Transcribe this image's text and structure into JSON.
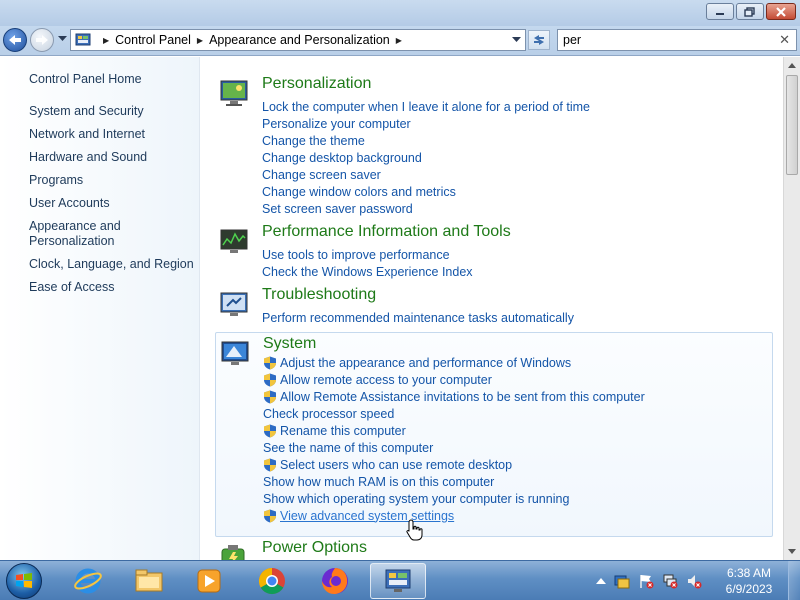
{
  "address_bar": {
    "breadcrumbs": [
      "Control Panel",
      "Appearance and Personalization"
    ],
    "search_value": "per"
  },
  "left_pane": {
    "home": "Control Panel Home",
    "items": [
      "System and Security",
      "Network and Internet",
      "Hardware and Sound",
      "Programs",
      "User Accounts",
      "Appearance and Personalization",
      "Clock, Language, and Region",
      "Ease of Access"
    ]
  },
  "sections": [
    {
      "title": "Personalization",
      "icon": "personalization-icon",
      "links": [
        {
          "label": "Lock the computer when I leave it alone for a period of time",
          "shield": false
        },
        {
          "label": "Personalize your computer",
          "shield": false
        },
        {
          "label": "Change the theme",
          "shield": false
        },
        {
          "label": "Change desktop background",
          "shield": false
        },
        {
          "label": "Change screen saver",
          "shield": false
        },
        {
          "label": "Change window colors and metrics",
          "shield": false
        },
        {
          "label": "Set screen saver password",
          "shield": false
        }
      ]
    },
    {
      "title": "Performance Information and Tools",
      "icon": "performance-icon",
      "links": [
        {
          "label": "Use tools to improve performance",
          "shield": false
        },
        {
          "label": "Check the Windows Experience Index",
          "shield": false
        }
      ]
    },
    {
      "title": "Troubleshooting",
      "icon": "troubleshooting-icon",
      "links": [
        {
          "label": "Perform recommended maintenance tasks automatically",
          "shield": false
        }
      ]
    },
    {
      "title": "System",
      "icon": "system-icon",
      "links": [
        {
          "label": "Adjust the appearance and performance of Windows",
          "shield": true
        },
        {
          "label": "Allow remote access to your computer",
          "shield": true
        },
        {
          "label": "Allow Remote Assistance invitations to be sent from this computer",
          "shield": true
        },
        {
          "label": "Check processor speed",
          "shield": false
        },
        {
          "label": "Rename this computer",
          "shield": true
        },
        {
          "label": "See the name of this computer",
          "shield": false
        },
        {
          "label": "Select users who can use remote desktop",
          "shield": true
        },
        {
          "label": "Show how much RAM is on this computer",
          "shield": false
        },
        {
          "label": "Show which operating system your computer is running",
          "shield": false
        },
        {
          "label": "View advanced system settings",
          "shield": true
        }
      ]
    },
    {
      "title": "Power Options",
      "icon": "power-options-icon",
      "links": []
    }
  ],
  "taskbar": {
    "apps": [
      "internet-explorer-icon",
      "windows-explorer-icon",
      "media-player-icon",
      "chrome-icon",
      "firefox-icon",
      "control-panel-icon"
    ],
    "time": "6:38 AM",
    "date": "6/9/2023"
  },
  "colors": {
    "section_title": "#1e7a18",
    "link": "#1455a8"
  }
}
